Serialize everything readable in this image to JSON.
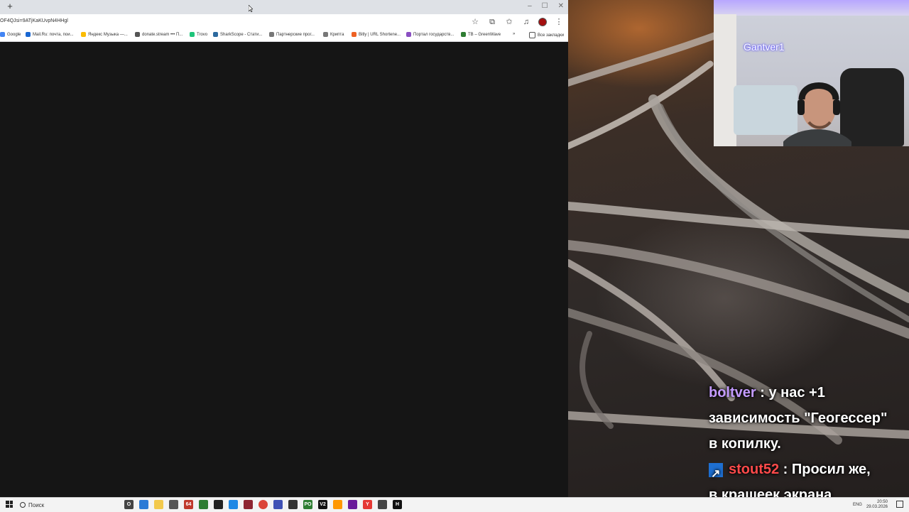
{
  "browser": {
    "new_tab_symbol": "+",
    "window_controls": [
      "–",
      "☐",
      "✕"
    ],
    "address": "OF4QJsi=9ATjKaKUvpN4HHgl",
    "toolbar_icons": [
      "star-icon",
      "extensions-icon",
      "bookmark-star-icon",
      "media-icon",
      "profile-avatar",
      "menu-icon"
    ],
    "bookmarks": [
      {
        "label": "Google",
        "color": "#4285f4"
      },
      {
        "label": "Mail.Ru: почта, пои...",
        "color": "#1967d2"
      },
      {
        "label": "Яндекс Музыка —...",
        "color": "#fbbc04"
      },
      {
        "label": "donate.stream ••• П...",
        "color": "#555555"
      },
      {
        "label": "Trovo",
        "color": "#1ec47a"
      },
      {
        "label": "SharkScope - Стати...",
        "color": "#2d6a9f"
      },
      {
        "label": "Партнерские прог...",
        "color": "#777777"
      },
      {
        "label": "Крипта",
        "color": "#777777"
      },
      {
        "label": "Bitly | URL Shortene...",
        "color": "#ee6123"
      },
      {
        "label": "Портал государств...",
        "color": "#8a4fc2"
      },
      {
        "label": "TB – GreenWave",
        "color": "#2e7d32"
      }
    ],
    "more_bookmarks_symbol": "»",
    "all_bookmarks": "Все закладки"
  },
  "stream": {
    "webcam_name": "Gantver1",
    "chat": [
      {
        "user": "boltver",
        "user_color": "#c49bff",
        "lines": [
          " : у нас +1",
          "зависимость \"Геогессер\"",
          "в копилку."
        ]
      },
      {
        "user": "stout52",
        "user_color": "#ff4a4a",
        "lines": [
          " : Просил же,",
          "в крашеек экрана"
        ]
      }
    ]
  },
  "taskbar": {
    "search_placeholder": "Поиск",
    "apps": [
      {
        "name": "cortana-icon",
        "label": "O",
        "color": "#444444"
      },
      {
        "name": "edge-legacy-icon",
        "label": "",
        "color": "#2b7bd6"
      },
      {
        "name": "file-explorer-icon",
        "label": "",
        "color": "#f2c94c"
      },
      {
        "name": "app-icon-tools",
        "label": "",
        "color": "#555555"
      },
      {
        "name": "app-icon-64",
        "label": "64",
        "color": "#c0392b"
      },
      {
        "name": "app-icon-green",
        "label": "",
        "color": "#2e7d32"
      },
      {
        "name": "app-icon-dark",
        "label": "",
        "color": "#222222"
      },
      {
        "name": "edge-icon",
        "label": "",
        "color": "#1e88e5"
      },
      {
        "name": "app-icon-red-grid",
        "label": "",
        "color": "#8e2430"
      },
      {
        "name": "chrome-icon",
        "label": "",
        "color": "#db4437"
      },
      {
        "name": "calculator-icon",
        "label": "",
        "color": "#3f51b5"
      },
      {
        "name": "app-icon-boat",
        "label": "",
        "color": "#333333"
      },
      {
        "name": "app-icon-po",
        "label": "PO",
        "color": "#2e7d32"
      },
      {
        "name": "app-icon-v2",
        "label": "V2",
        "color": "#111111"
      },
      {
        "name": "app-icon-orange",
        "label": "",
        "color": "#ff9800"
      },
      {
        "name": "app-icon-purple",
        "label": "",
        "color": "#6a1b9a"
      },
      {
        "name": "yandex-icon",
        "label": "Y",
        "color": "#e53935"
      },
      {
        "name": "app-icon-globe",
        "label": "",
        "color": "#444444"
      },
      {
        "name": "app-icon-h",
        "label": "H",
        "color": "#111111"
      }
    ],
    "language": "ENG",
    "time": "20:50",
    "date": "29.03.2026"
  }
}
